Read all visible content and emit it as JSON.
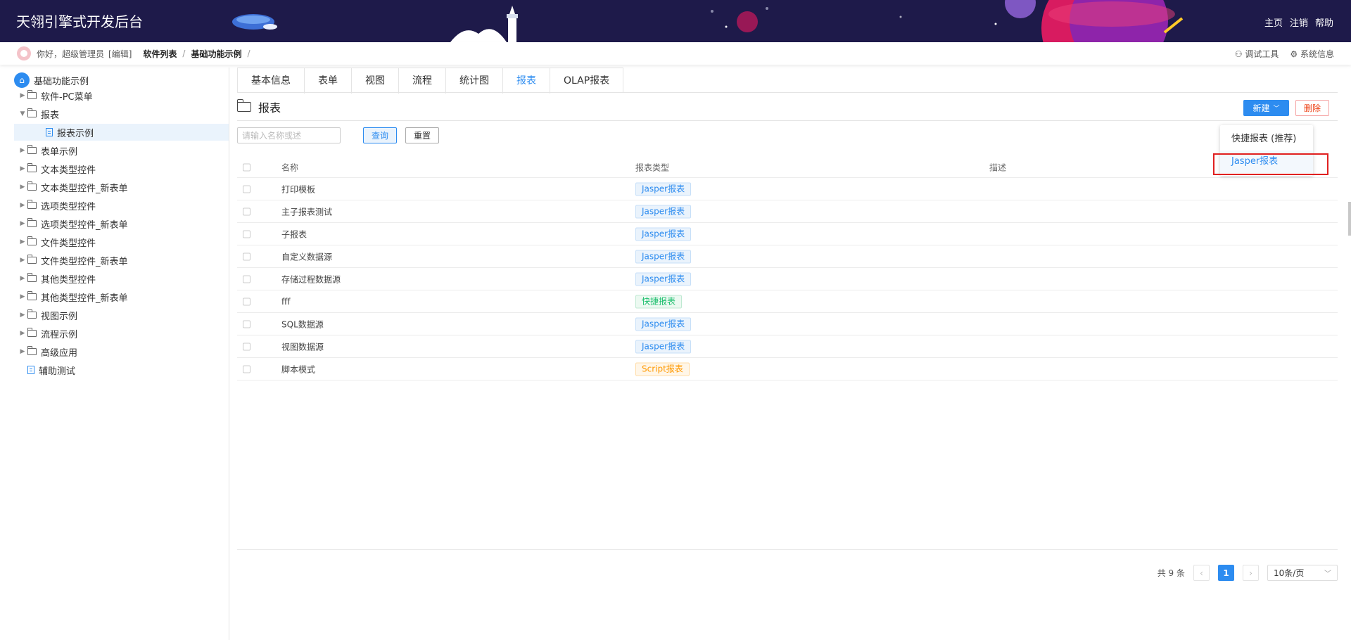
{
  "header": {
    "title": "天翎引擎式开发后台",
    "links": [
      "主页",
      "注销",
      "帮助"
    ]
  },
  "crumbs": {
    "greeting": "你好，超级管理员",
    "edit": "[编辑]",
    "items": [
      "软件列表",
      "基础功能示例"
    ],
    "sep": "/",
    "tools": [
      "调试工具",
      "系统信息"
    ]
  },
  "tree": {
    "root": "基础功能示例",
    "items": [
      {
        "label": "软件-PC菜单"
      },
      {
        "label": "报表"
      },
      {
        "label": "报表示例"
      },
      {
        "label": "表单示例"
      },
      {
        "label": "文本类型控件"
      },
      {
        "label": "文本类型控件_新表单"
      },
      {
        "label": "选项类型控件"
      },
      {
        "label": "选项类型控件_新表单"
      },
      {
        "label": "文件类型控件"
      },
      {
        "label": "文件类型控件_新表单"
      },
      {
        "label": "其他类型控件"
      },
      {
        "label": "其他类型控件_新表单"
      },
      {
        "label": "视图示例"
      },
      {
        "label": "流程示例"
      },
      {
        "label": "高级应用"
      },
      {
        "label": "辅助测试"
      }
    ]
  },
  "tabs": [
    "基本信息",
    "表单",
    "视图",
    "流程",
    "统计图",
    "报表",
    "OLAP报表"
  ],
  "page": {
    "title": "报表",
    "new_label": "新建",
    "delete_label": "删除"
  },
  "search": {
    "placeholder": "请输入名称或述",
    "query_label": "查询",
    "reset_label": "重置"
  },
  "table": {
    "headers": [
      "名称",
      "报表类型",
      "描述"
    ],
    "rows": [
      {
        "name": "打印模板",
        "type": "Jasper报表"
      },
      {
        "name": "主子报表测试",
        "type": "Jasper报表"
      },
      {
        "name": "子报表",
        "type": "Jasper报表"
      },
      {
        "name": "自定义数据源",
        "type": "Jasper报表"
      },
      {
        "name": "存储过程数据源",
        "type": "Jasper报表"
      },
      {
        "name": "fff",
        "type": "快捷报表"
      },
      {
        "name": "SQL数据源",
        "type": "Jasper报表"
      },
      {
        "name": "视图数据源",
        "type": "Jasper报表"
      },
      {
        "name": "脚本模式",
        "type": "Script报表"
      }
    ]
  },
  "pager": {
    "total": "共 9 条",
    "current": "1",
    "page_size": "10条/页"
  },
  "dropdown": {
    "items": [
      "快捷报表 (推荐)",
      "Jasper报表"
    ]
  },
  "colors": {
    "header_bg": "#1e1a4a",
    "accent": "#2d8cf0",
    "danger": "#ed4014",
    "highlight": "#e02020"
  }
}
